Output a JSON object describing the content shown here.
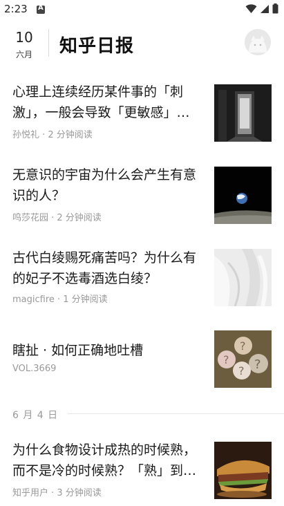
{
  "status": {
    "time": "2:23"
  },
  "header": {
    "day": "10",
    "month": "六月",
    "title": "知乎日报"
  },
  "stories": [
    {
      "title": "心理上连续经历某件事的「刺激」，一般会导致「更敏感」还是「更麻木」？",
      "meta": "孙悦礼 · 2 分钟阅读",
      "image": "dark doorway"
    },
    {
      "title": "无意识的宇宙为什么会产生有意识的人？",
      "meta": "呜莎花园 · 2 分钟阅读",
      "image": "earth over moon"
    },
    {
      "title": "古代白绫赐死痛苦吗？为什么有的妃子不选毒酒选白绫？",
      "meta": "magicfire · 1 分钟阅读",
      "image": "white silk"
    },
    {
      "title": "瞎扯 · 如何正确地吐槽",
      "meta": "VOL.3669",
      "image": "question marks"
    }
  ],
  "section": {
    "label": "6 月 4 日"
  },
  "stories2": [
    {
      "title": "为什么食物设计成热的时候熟，而不是冷的时候熟？「熟」到底是怎么回事？",
      "meta": "知乎用户 · 3 分钟阅读",
      "image": "sandwich"
    }
  ],
  "colors": {
    "accent": "#1a1a1a",
    "meta": "#999999",
    "divider": "#e6e6e6"
  }
}
